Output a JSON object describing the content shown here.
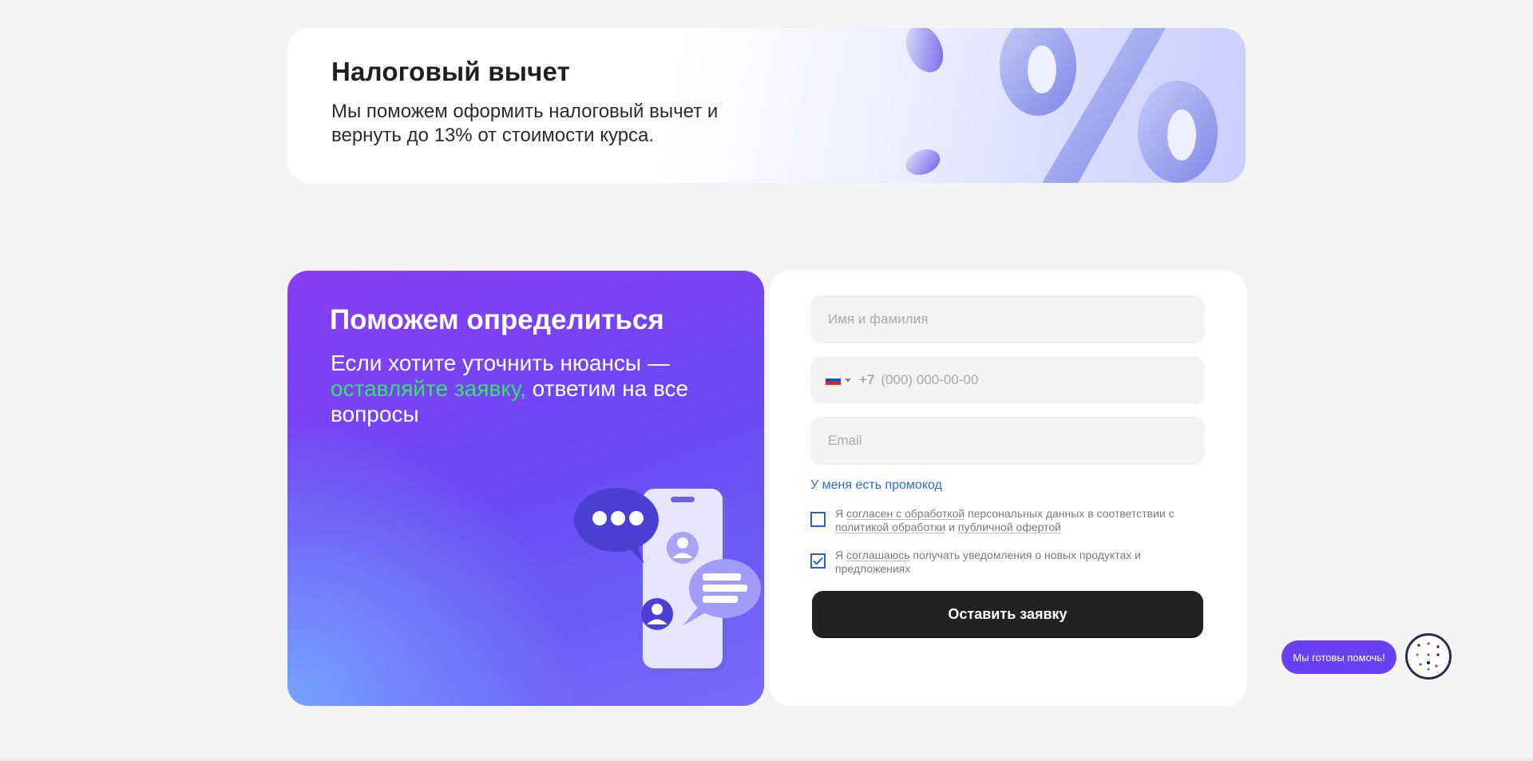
{
  "tax_banner": {
    "title": "Налоговый вычет",
    "text": "Мы поможем оформить налоговый вычет и вернуть до 13% от стоимости курса."
  },
  "promo": {
    "title": "Поможем определиться",
    "text_before": "Если хотите уточнить нюансы — ",
    "text_accent": "оставляйте заявку,",
    "text_after": " ответим на все вопросы",
    "accent_color": "#35e36a"
  },
  "form": {
    "name_placeholder": "Имя и фамилия",
    "phone_prefix": "+7",
    "phone_placeholder": "(000) 000-00-00",
    "email_placeholder": "Email",
    "promo_link": "У меня есть промокод",
    "consent1": {
      "checked": false,
      "t1": "Я ",
      "link1": "согласен с обработкой",
      "t2": " персональных данных в соответствии с ",
      "link2": "политикой обработки",
      "t3": " и ",
      "link3": "публичной офертой"
    },
    "consent2": {
      "checked": true,
      "t1": "Я ",
      "link1": "соглашаюсь",
      "t2": " получать уведомления о новых продуктах и предложениях"
    },
    "submit_label": "Оставить заявку",
    "country_icon": "russia-flag-icon"
  },
  "help_widget": {
    "label": "Мы готовы помочь!"
  },
  "colors": {
    "link": "#2b6ad8",
    "button": "#222222",
    "checkbox": "#2b5fd8",
    "help": "#6b3ff2"
  }
}
